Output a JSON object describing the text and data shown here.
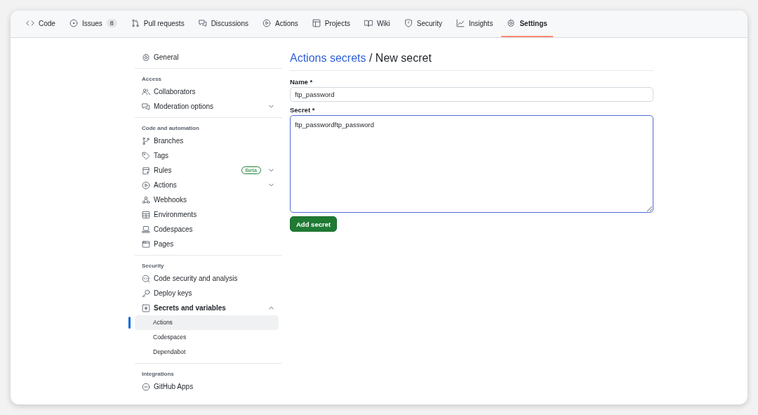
{
  "tabs": [
    {
      "label": "Code",
      "selected": false
    },
    {
      "label": "Issues",
      "selected": false,
      "counter": "8"
    },
    {
      "label": "Pull requests",
      "selected": false
    },
    {
      "label": "Discussions",
      "selected": false
    },
    {
      "label": "Actions",
      "selected": false
    },
    {
      "label": "Projects",
      "selected": false
    },
    {
      "label": "Wiki",
      "selected": false
    },
    {
      "label": "Security",
      "selected": false
    },
    {
      "label": "Insights",
      "selected": false
    },
    {
      "label": "Settings",
      "selected": true
    }
  ],
  "sidebar": {
    "sections": [
      {
        "items": [
          {
            "label": "General"
          }
        ]
      },
      {
        "heading": "Access",
        "items": [
          {
            "label": "Collaborators"
          },
          {
            "label": "Moderation options",
            "expanded": false
          }
        ]
      },
      {
        "heading": "Code and automation",
        "items": [
          {
            "label": "Branches"
          },
          {
            "label": "Tags"
          },
          {
            "label": "Rules",
            "badge": "Beta",
            "expanded": false
          },
          {
            "label": "Actions",
            "expanded": false
          },
          {
            "label": "Webhooks"
          },
          {
            "label": "Environments"
          },
          {
            "label": "Codespaces"
          },
          {
            "label": "Pages"
          }
        ]
      },
      {
        "heading": "Security",
        "items": [
          {
            "label": "Code security and analysis"
          },
          {
            "label": "Deploy keys"
          },
          {
            "label": "Secrets and variables",
            "expanded": true,
            "children": [
              {
                "label": "Actions",
                "selected": true
              },
              {
                "label": "Codespaces",
                "selected": false
              },
              {
                "label": "Dependabot",
                "selected": false
              }
            ]
          }
        ]
      },
      {
        "heading": "Integrations",
        "items": [
          {
            "label": "GitHub Apps"
          }
        ]
      }
    ]
  },
  "breadcrumb": {
    "link": "Actions secrets",
    "current": "/ New secret"
  },
  "form": {
    "name_label": "Name *",
    "name_value": "ftp_password",
    "secret_label": "Secret *",
    "secret_value": "ftp_passwordftp_password",
    "submit": "Add secret"
  }
}
